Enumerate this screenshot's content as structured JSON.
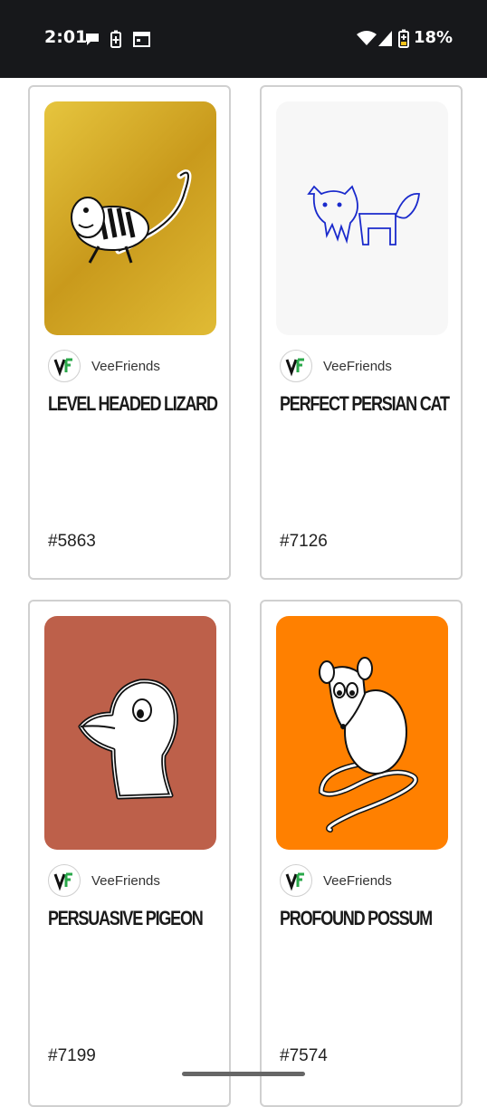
{
  "status_bar": {
    "time": "2:01",
    "battery_percent": "18%",
    "left_icons": [
      "chat-bubble-icon",
      "battery-saver-icon",
      "calendar-icon"
    ],
    "right_icons": [
      "wifi-icon",
      "cell-signal-icon",
      "battery-icon"
    ]
  },
  "cards": [
    {
      "creator": "VeeFriends",
      "title": "LEVEL HEADED LIZARD",
      "number": "#5863",
      "art_bg": "#d9b231",
      "art_icon": "lizard-illustration"
    },
    {
      "creator": "VeeFriends",
      "title": "PERFECT PERSIAN CAT",
      "number": "#7126",
      "art_bg": "#f7f7f7",
      "art_icon": "cat-illustration"
    },
    {
      "creator": "VeeFriends",
      "title": "PERSUASIVE PIGEON",
      "number": "#7199",
      "art_bg": "#bd604a",
      "art_icon": "pigeon-illustration"
    },
    {
      "creator": "VeeFriends",
      "title": "PROFOUND POSSUM",
      "number": "#7574",
      "art_bg": "#ff8000",
      "art_icon": "possum-illustration"
    }
  ],
  "colors": {
    "status_bar": "#17181b",
    "card_border": "#d0d0d0",
    "logo_green": "#2aa84a"
  }
}
